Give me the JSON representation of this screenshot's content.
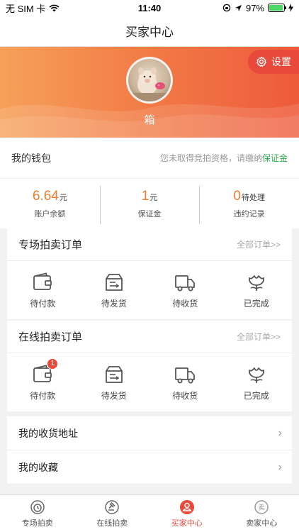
{
  "status_bar": {
    "carrier": "无 SIM 卡",
    "time": "11:40",
    "battery": "97%",
    "battery_level": 0.97
  },
  "nav": {
    "title": "买家中心"
  },
  "banner": {
    "settings_label": "设置",
    "username": "箱"
  },
  "wallet": {
    "title": "我的钱包",
    "tip_prefix": "您未取得竞拍资格，请缴纳",
    "tip_link": "保证金",
    "stats": [
      {
        "value": "6.64",
        "unit": "元",
        "label": "账户余额"
      },
      {
        "value": "1",
        "unit": "元",
        "label": "保证金"
      },
      {
        "value": "0",
        "unit": "待处理",
        "label": "违约记录"
      }
    ]
  },
  "special_orders": {
    "title": "专场拍卖订单",
    "more": "全部订单>>",
    "items": [
      {
        "label": "待付款",
        "icon": "wallet-icon"
      },
      {
        "label": "待发货",
        "icon": "box-icon"
      },
      {
        "label": "待收货",
        "icon": "truck-icon"
      },
      {
        "label": "已完成",
        "icon": "flower-icon"
      }
    ]
  },
  "online_orders": {
    "title": "在线拍卖订单",
    "more": "全部订单>>",
    "badge": "1",
    "items": [
      {
        "label": "待付款",
        "icon": "wallet-icon"
      },
      {
        "label": "待发货",
        "icon": "box-icon"
      },
      {
        "label": "待收货",
        "icon": "truck-icon"
      },
      {
        "label": "已完成",
        "icon": "flower-icon"
      }
    ]
  },
  "list": [
    {
      "label": "我的收货地址"
    },
    {
      "label": "我的收藏"
    }
  ],
  "tabs": [
    {
      "label": "专场拍卖",
      "icon": "clock-icon"
    },
    {
      "label": "在线拍卖",
      "icon": "gavel-icon"
    },
    {
      "label": "买家中心",
      "icon": "user-icon",
      "active": true
    },
    {
      "label": "卖家中心",
      "icon": "seller-icon"
    }
  ],
  "colors": {
    "accent": "#e8493a",
    "price": "#f07d2e",
    "link": "#2fa84f"
  }
}
